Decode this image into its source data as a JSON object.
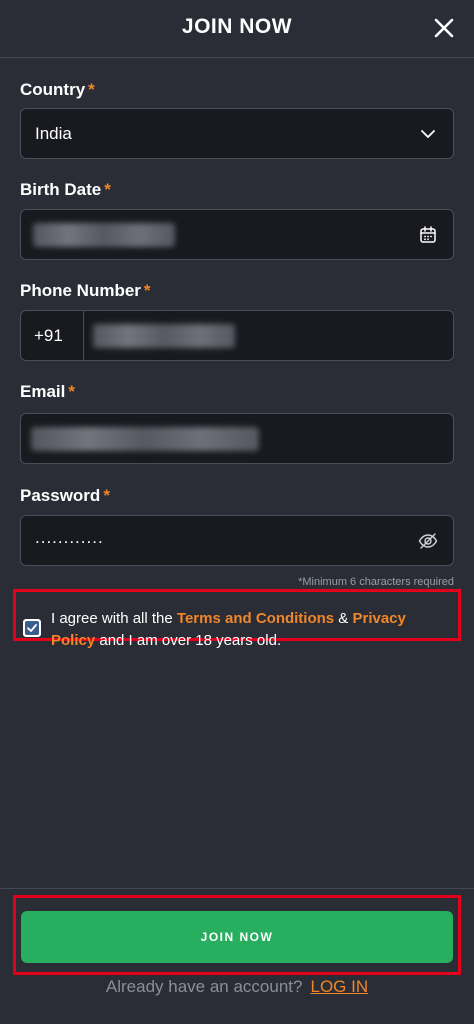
{
  "header": {
    "title": "JOIN NOW"
  },
  "form": {
    "country": {
      "label": "Country",
      "required_mark": "*",
      "value": "India"
    },
    "birth_date": {
      "label": "Birth Date",
      "required_mark": "*"
    },
    "phone": {
      "label": "Phone Number",
      "required_mark": "*",
      "prefix": "+91"
    },
    "email": {
      "label": "Email",
      "required_mark": "*"
    },
    "password": {
      "label": "Password",
      "required_mark": "*",
      "value": "............",
      "hint": "*Minimum 6 characters required"
    },
    "agree": {
      "checked": true,
      "text_1": "I agree with all the ",
      "terms_link": "Terms and Conditions",
      "text_2": " & ",
      "privacy_link": "Privacy Policy",
      "text_3": " and I am over 18 years old."
    }
  },
  "footer": {
    "join_button": "JOIN NOW",
    "login_prompt": "Already have an account?",
    "login_link": "LOG IN"
  },
  "colors": {
    "accent": "#f0862a",
    "primary_button": "#27ae5f",
    "highlight_border": "#e3001b",
    "background": "#2a2d36",
    "field_bg": "#181a1f"
  }
}
